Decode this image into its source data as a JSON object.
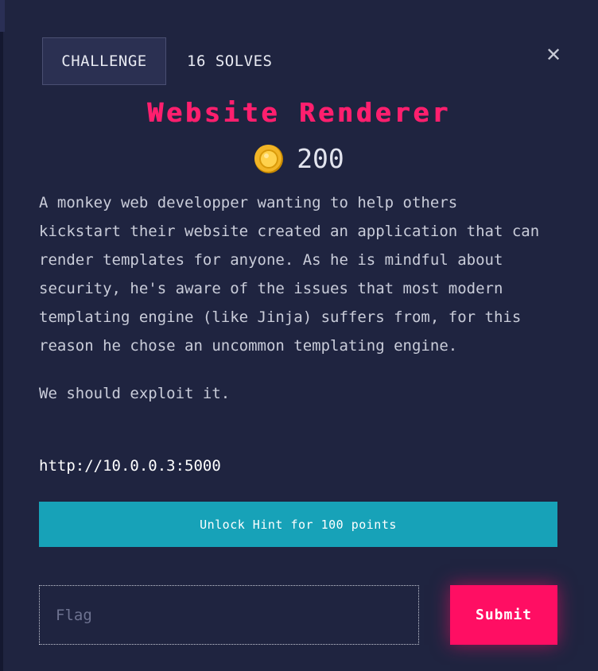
{
  "tabs": {
    "challenge_label": "CHALLENGE",
    "solves_label": "16 SOLVES"
  },
  "close_icon": "close-icon",
  "challenge": {
    "title": "Website Renderer",
    "points": "200",
    "coin_icon": "coin-icon",
    "description": [
      "A monkey web developper wanting to help others kickstart their website created an application that can render templates for anyone. As he is mindful about security, he's aware of the issues that most modern templating engine (like Jinja) suffers from, for this reason he chose an uncommon templating engine.",
      "We should exploit it."
    ],
    "url": "http://10.0.0.3:5000"
  },
  "hint": {
    "label": "Unlock Hint for 100 points"
  },
  "flag_form": {
    "placeholder": "Flag",
    "value": "",
    "submit_label": "Submit"
  },
  "colors": {
    "background": "#1f2440",
    "title": "#ff1f6e",
    "hint_button": "#17a2b8",
    "submit_button": "#ff0e63"
  }
}
